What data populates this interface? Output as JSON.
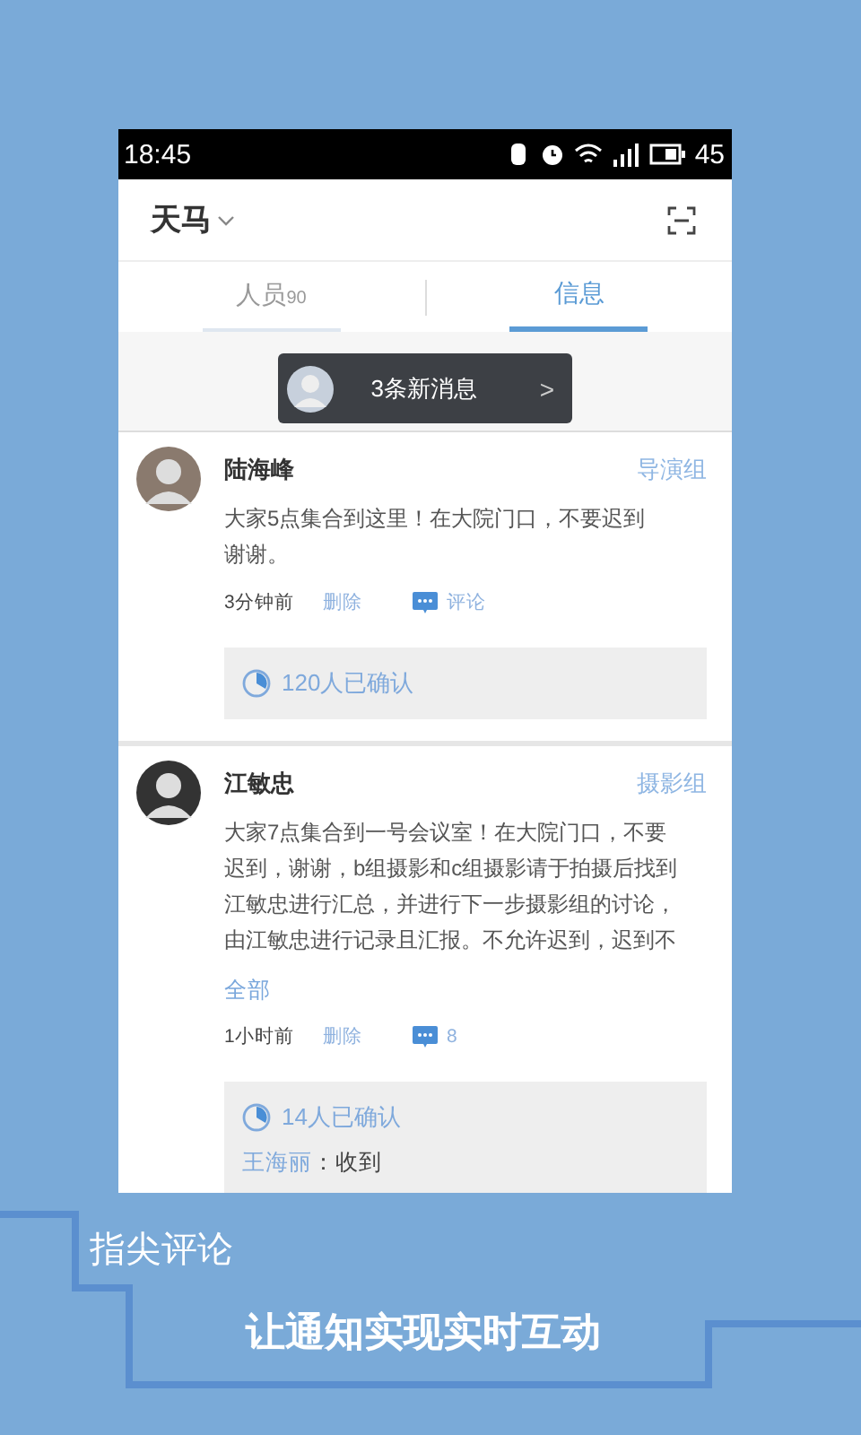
{
  "status_bar": {
    "time": "18:45",
    "battery": "45"
  },
  "header": {
    "title": "天马"
  },
  "tabs": [
    {
      "label": "人员",
      "count": "90",
      "selected": false
    },
    {
      "label": "信息",
      "selected": true
    }
  ],
  "new_messages": {
    "text": "3条新消息",
    "arrow": ">"
  },
  "posts": [
    {
      "name": "陆海峰",
      "group": "导演组",
      "body_lines": [
        "大家5点集合到这里！在大院门口，不要迟到",
        "谢谢。"
      ],
      "time": "3分钟前",
      "delete": "删除",
      "comment": "评论",
      "confirmed": "120人已确认"
    },
    {
      "name": "江敏忠",
      "group": "摄影组",
      "body_lines": [
        "大家7点集合到一号会议室！在大院门口，不要",
        "迟到，谢谢，b组摄影和c组摄影请于拍摄后找到",
        "江敏忠进行汇总，并进行下一步摄影组的讨论，",
        "由江敏忠进行记录且汇报。不允许迟到，迟到不"
      ],
      "more": "全部",
      "time": "1小时前",
      "delete": "删除",
      "comment": "8",
      "confirmed": "14人已确认",
      "replies": [
        {
          "name": "王海丽",
          "text": "：收到"
        }
      ]
    }
  ],
  "tagline": {
    "title": "指尖评论",
    "subtitle": "让通知实现实时互动"
  }
}
